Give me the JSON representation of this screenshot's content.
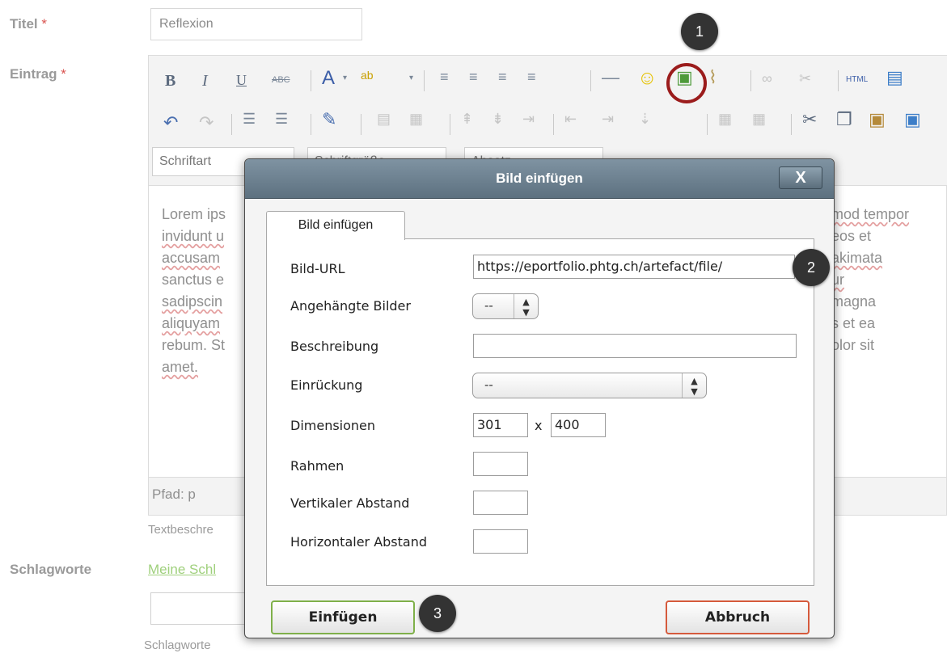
{
  "form": {
    "title_label": "Titel",
    "required_marker": "*",
    "title_value": "Reflexion",
    "entry_label": "Eintrag",
    "tags_label": "Schlagworte",
    "my_tags_link": "Meine Schl",
    "text_description": "Textbeschre",
    "tags_help": "Schlagworte"
  },
  "editor": {
    "font_select": "Schriftart",
    "size_select": "Schriftgröße",
    "format_select": "Absatz",
    "html_label": "HTML",
    "content_lines": [
      "Lorem ips",
      "invidunt u",
      "accusam",
      "sanctus e",
      "sadipscin",
      "aliquyam",
      "rebum. St",
      "amet."
    ],
    "content_right": [
      "mod tempor",
      "eos et",
      "akimata",
      "ur",
      "magna",
      "s et ea",
      "olor sit"
    ],
    "path_label": "Pfad: p"
  },
  "dialog": {
    "title": "Bild einfügen",
    "close_label": "X",
    "tab_label": "Bild einfügen",
    "fields": {
      "image_url_label": "Bild-URL",
      "image_url_value": "https://eportfolio.phtg.ch/artefact/file/",
      "attached_label": "Angehängte Bilder",
      "attached_value": "--",
      "description_label": "Beschreibung",
      "description_value": "",
      "indent_label": "Einrückung",
      "indent_value": "--",
      "dimensions_label": "Dimensionen",
      "width_value": "301",
      "dim_separator": "x",
      "height_value": "400",
      "border_label": "Rahmen",
      "vspace_label": "Vertikaler Abstand",
      "hspace_label": "Horizontaler Abstand"
    },
    "insert_button": "Einfügen",
    "cancel_button": "Abbruch"
  },
  "callouts": [
    "1",
    "2",
    "3"
  ],
  "colors": {
    "dialog_header": "#6b7f8d",
    "insert_border": "#7fb04a",
    "cancel_border": "#d55a3c",
    "highlight_ring": "#9b1c1c",
    "callout_bg": "#333333"
  }
}
